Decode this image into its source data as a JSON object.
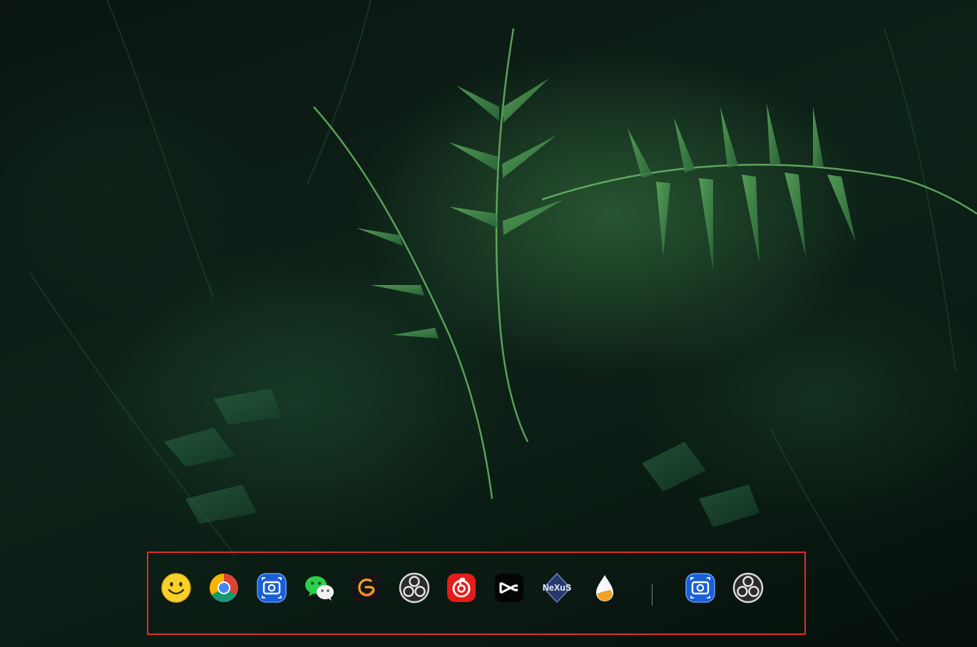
{
  "desktop": {
    "wallpaper": "fern-leaves"
  },
  "dock": {
    "highlight_color": "#e02d24",
    "items": [
      {
        "name": "smiley-app-icon",
        "icon": "yellow-smiley-face"
      },
      {
        "name": "chrome-icon",
        "icon": "google-chrome"
      },
      {
        "name": "screen-capture-icon",
        "icon": "blue-screenshot-camera"
      },
      {
        "name": "wechat-icon",
        "icon": "wechat-chat-bubbles"
      },
      {
        "name": "swirl-app-icon",
        "icon": "orange-swirl-letter"
      },
      {
        "name": "obs-icon",
        "icon": "obs-studio"
      },
      {
        "name": "netease-music-icon",
        "icon": "netease-cloud-music"
      },
      {
        "name": "capcut-icon",
        "icon": "capcut-scissors"
      },
      {
        "name": "nexus-icon",
        "icon": "nexus-diamond",
        "label": "NeXuS"
      },
      {
        "name": "water-drop-icon",
        "icon": "water-drop"
      },
      {
        "name": "screen-capture-icon-recent",
        "icon": "blue-screenshot-camera"
      },
      {
        "name": "obs-icon-recent",
        "icon": "obs-studio"
      }
    ]
  }
}
